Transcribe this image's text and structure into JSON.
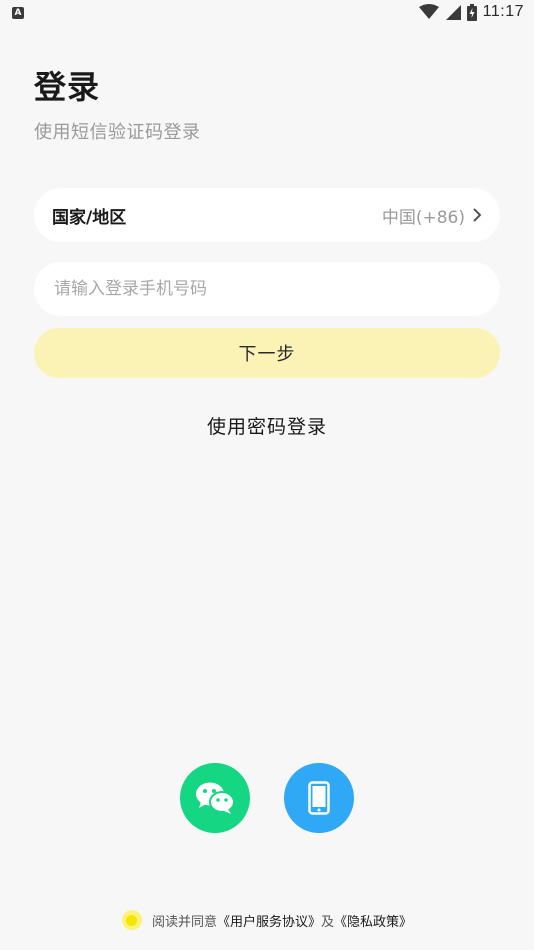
{
  "status_bar": {
    "badge": "A",
    "time": "11:17"
  },
  "header": {
    "title": "登录",
    "subtitle": "使用短信验证码登录"
  },
  "region": {
    "label": "国家/地区",
    "value": "中国(+86)"
  },
  "phone": {
    "placeholder": "请输入登录手机号码",
    "value": ""
  },
  "next_button": {
    "label": "下一步"
  },
  "password_login": {
    "label": "使用密码登录"
  },
  "social": {
    "wechat_icon": "wechat-icon",
    "phone_icon": "smartphone-icon"
  },
  "agreement": {
    "prefix": "阅读并同意",
    "terms": "《用户服务协议》",
    "and": "及",
    "privacy": "《隐私政策》"
  },
  "colors": {
    "background": "#f7f7f7",
    "next_button": "#fbf3b6",
    "wechat": "#14d683",
    "phone": "#2fa8f5",
    "agree_radio": "#f5e600"
  }
}
